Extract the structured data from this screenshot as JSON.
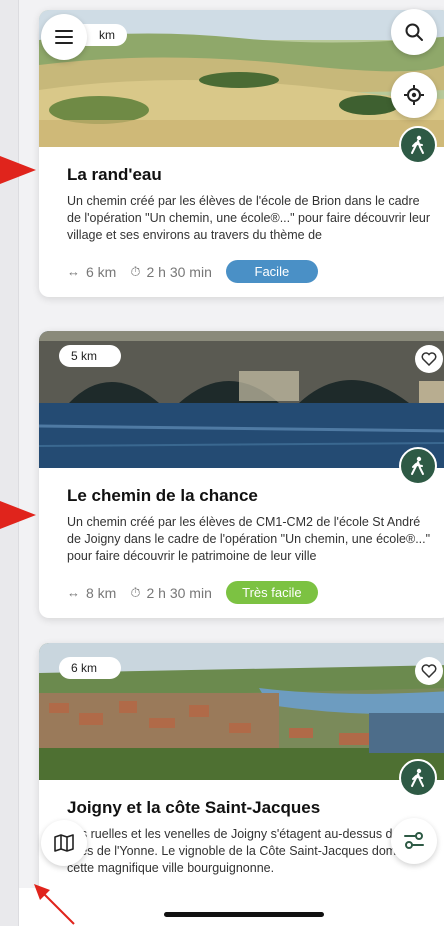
{
  "cards": [
    {
      "title": "La rand'eau",
      "distance_badge": "km",
      "description": "Un chemin créé par les élèves de l'école de Brion dans le cadre de l'opération \"Un chemin, une école®...\" pour faire découvrir leur village et ses environs au travers du thème de",
      "distance": "6 km",
      "duration": "2 h 30 min",
      "difficulty": "Facile",
      "difficulty_color": "#4a90c6"
    },
    {
      "title": "Le chemin de la chance",
      "distance_badge": "5 km",
      "description": "Un chemin créé par les élèves de CM1-CM2 de l'école St André de Joigny dans le cadre de l'opération \"Un chemin, une école®...\" pour faire découvrir le patrimoine de leur ville",
      "distance": "8 km",
      "duration": "2 h 30 min",
      "difficulty": "Très facile",
      "difficulty_color": "#7cc242"
    },
    {
      "title": "Joigny et la côte Saint-Jacques",
      "distance_badge": "6 km",
      "description": "Les ruelles et les venelles de Joigny s'étagent au-dessus des rives de l'Yonne. Le vignoble de la Côte Saint-Jacques domine cette magnifique ville bourguignonne.",
      "distance": "",
      "duration": "",
      "difficulty": "",
      "difficulty_color": "#4a90c6"
    }
  ],
  "icons": {
    "menu": "menu-icon",
    "search": "search-icon",
    "locate": "locate-icon",
    "map": "map-icon",
    "filter": "filter-icon",
    "hike": "hiker-icon",
    "favorite": "heart-icon",
    "distance": "arrows-icon",
    "duration": "timer-icon"
  },
  "colors": {
    "hike_badge": "#2e5a45",
    "annotation_arrow": "#e0241c"
  },
  "meta_symbols": {
    "distance": "↔",
    "duration": "⏱"
  }
}
